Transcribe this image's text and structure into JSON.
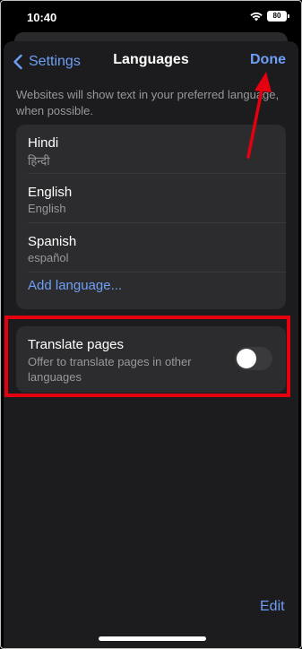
{
  "status_bar": {
    "time": "10:40",
    "battery": "80"
  },
  "nav": {
    "back_label": "Settings",
    "title": "Languages",
    "done_label": "Done"
  },
  "note": "Websites will show text in your preferred language, when possible.",
  "languages": [
    {
      "name": "Hindi",
      "native": "हिन्दी"
    },
    {
      "name": "English",
      "native": "English"
    },
    {
      "name": "Spanish",
      "native": "español"
    }
  ],
  "add_language_label": "Add language...",
  "translate": {
    "title": "Translate pages",
    "subtitle": "Offer to translate pages in other languages",
    "enabled": false
  },
  "edit_label": "Edit",
  "colors": {
    "accent": "#6e9ff7",
    "annotation": "#e5000f",
    "background": "#1c1c1e",
    "card": "#2c2c2e"
  }
}
